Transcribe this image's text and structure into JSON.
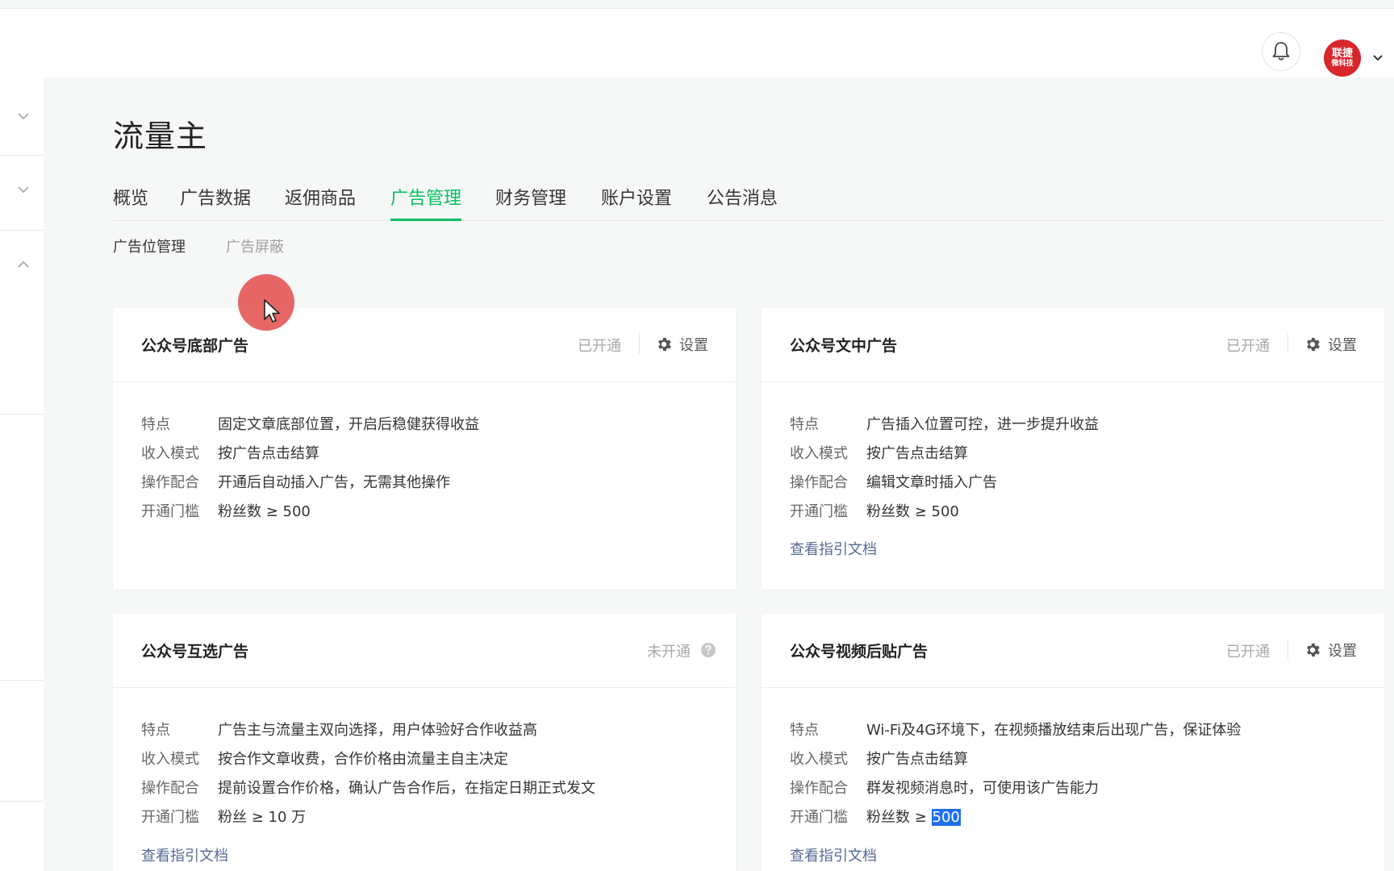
{
  "header": {
    "bell_icon": "bell-icon",
    "avatar_text_line1": "联捷",
    "avatar_text_line2": "微科技",
    "dropdown_icon": "chevron-down-icon"
  },
  "page": {
    "title": "流量主"
  },
  "tabs": [
    {
      "label": "概览"
    },
    {
      "label": "广告数据"
    },
    {
      "label": "返佣商品"
    },
    {
      "label": "广告管理",
      "active": true
    },
    {
      "label": "财务管理"
    },
    {
      "label": "账户设置"
    },
    {
      "label": "公告消息"
    }
  ],
  "subtabs": [
    {
      "label": "广告位管理",
      "active": true
    },
    {
      "label": "广告屏蔽"
    }
  ],
  "cards": [
    {
      "title": "公众号底部广告",
      "status": "已开通",
      "settings_label": "设置",
      "rows": [
        {
          "k": "特点",
          "v": "固定文章底部位置，开启后稳健获得收益"
        },
        {
          "k": "收入模式",
          "v": "按广告点击结算"
        },
        {
          "k": "操作配合",
          "v": "开通后自动插入广告，无需其他操作"
        },
        {
          "k": "开通门槛",
          "v": "粉丝数 ≥ 500"
        }
      ]
    },
    {
      "title": "公众号文中广告",
      "status": "已开通",
      "settings_label": "设置",
      "rows": [
        {
          "k": "特点",
          "v": "广告插入位置可控，进一步提升收益"
        },
        {
          "k": "收入模式",
          "v": "按广告点击结算"
        },
        {
          "k": "操作配合",
          "v": "编辑文章时插入广告"
        },
        {
          "k": "开通门槛",
          "v": "粉丝数 ≥ 500"
        }
      ],
      "link": "查看指引文档"
    },
    {
      "title": "公众号互选广告",
      "status": "未开通",
      "rows": [
        {
          "k": "特点",
          "v": "广告主与流量主双向选择，用户体验好合作收益高"
        },
        {
          "k": "收入模式",
          "v": "按合作文章收费，合作价格由流量主自主决定"
        },
        {
          "k": "操作配合",
          "v": "提前设置合作价格，确认广告合作后，在指定日期正式发文"
        },
        {
          "k": "开通门槛",
          "v": "粉丝 ≥ 10 万"
        }
      ],
      "link": "查看指引文档"
    },
    {
      "title": "公众号视频后贴广告",
      "status": "已开通",
      "settings_label": "设置",
      "rows": [
        {
          "k": "特点",
          "v": "Wi-Fi及4G环境下，在视频播放结束后出现广告，保证体验"
        },
        {
          "k": "收入模式",
          "v": "按广告点击结算"
        },
        {
          "k": "操作配合",
          "v": "群发视频消息时，可使用该广告能力"
        }
      ],
      "threshold_key": "开通门槛",
      "threshold_prefix": "粉丝数 ≥ ",
      "threshold_value": "500",
      "link": "查看指引文档"
    }
  ],
  "colors": {
    "accent": "#07c160",
    "link": "#576b95",
    "selection": "#1e6ff0",
    "avatar": "#d8272c"
  }
}
